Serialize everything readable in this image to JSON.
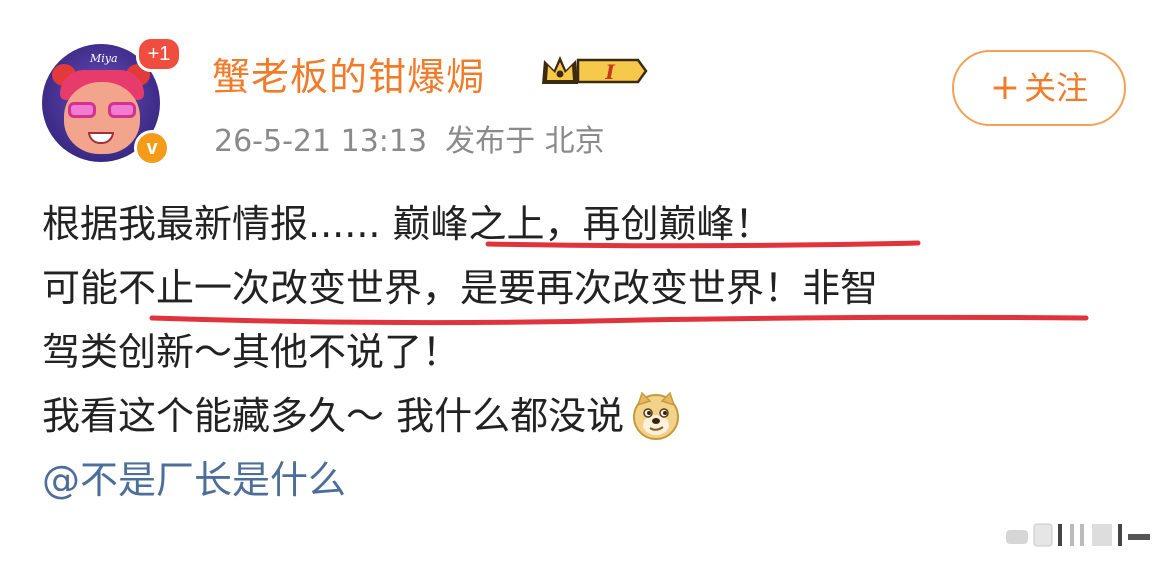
{
  "header": {
    "avatar_sig": "Miya",
    "plus_badge": "+1",
    "verify_badge": "v",
    "username": "蟹老板的钳爆焗",
    "vip_level": "I",
    "date": "26-5-21 13:13",
    "location": "发布于 北京",
    "follow_label": "关注",
    "follow_plus": "+"
  },
  "post": {
    "line1": "根据我最新情报...... 巅峰之上，再创巅峰！",
    "line2": "可能不止一次改变世界，是要再次改变世界！非智",
    "line3": "驾类创新～其他不说了！",
    "line4": "我看这个能藏多久～ 我什么都没说",
    "mention": "@不是厂长是什么"
  },
  "icons": {
    "doge_emoji": "doge-emoji-icon",
    "crown": "crown-icon",
    "verify": "verified-v-icon"
  },
  "colors": {
    "username": "#f07b2a",
    "mention": "#4e6e9a",
    "underline": "#e0333c",
    "meta": "#8a8a8a"
  }
}
